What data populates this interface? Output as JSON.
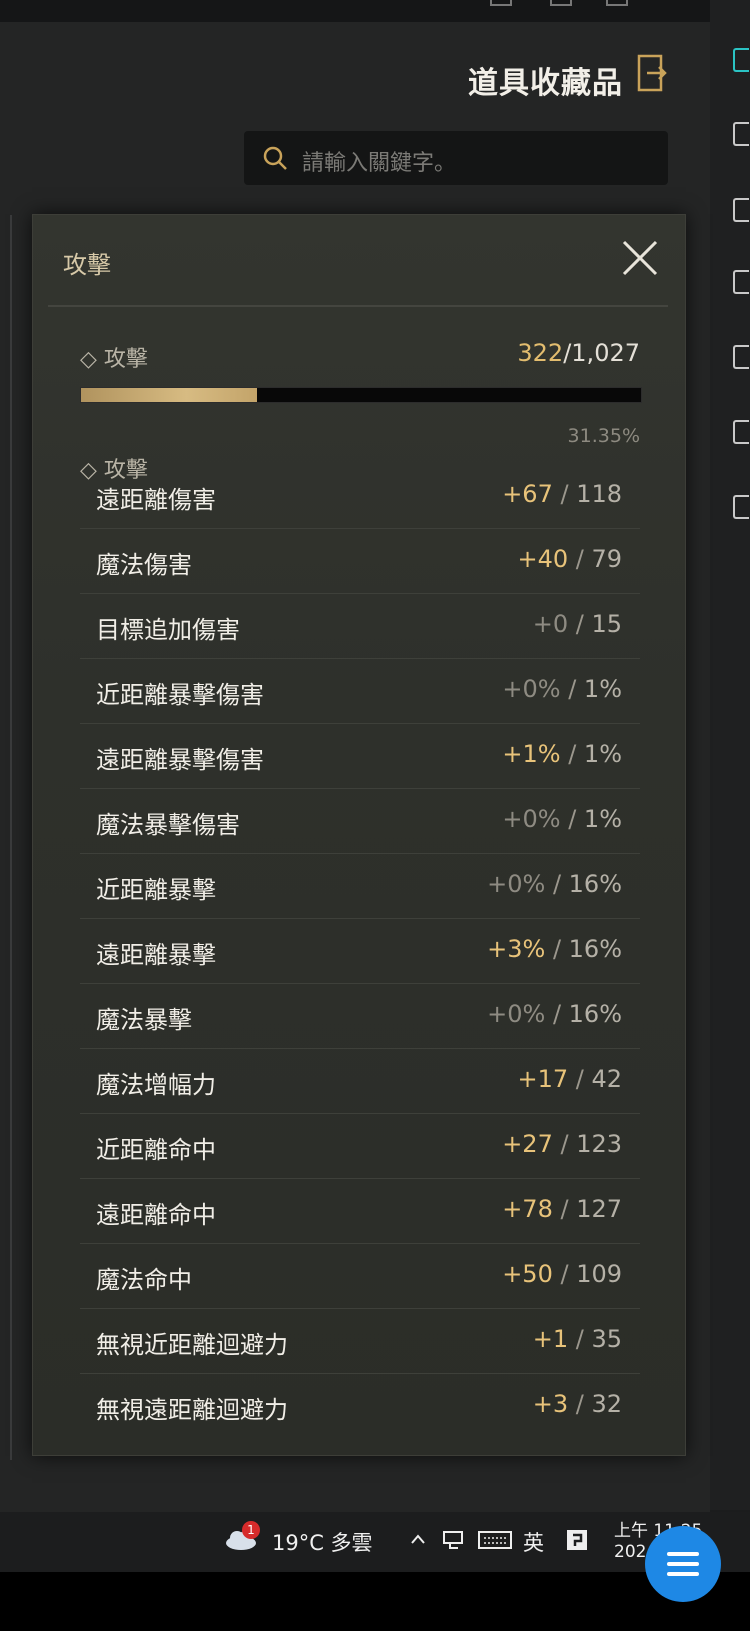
{
  "header": {
    "title": "道具收藏品"
  },
  "search": {
    "placeholder": "請輸入關鍵字。"
  },
  "panel": {
    "title": "攻擊",
    "summary": {
      "label": "◇ 攻擊",
      "current": "322",
      "total": "/1,027",
      "percent_text": "31.35%",
      "progress": 0.3135
    },
    "section_label": "◇ 攻擊",
    "rows": [
      {
        "name": "遠距離傷害",
        "bonus": "+67",
        "max": "118",
        "zero": false
      },
      {
        "name": "魔法傷害",
        "bonus": "+40",
        "max": "79",
        "zero": false
      },
      {
        "name": "目標追加傷害",
        "bonus": "+0",
        "max": "15",
        "zero": true
      },
      {
        "name": "近距離暴擊傷害",
        "bonus": "+0%",
        "max": "1%",
        "zero": true
      },
      {
        "name": "遠距離暴擊傷害",
        "bonus": "+1%",
        "max": "1%",
        "zero": false
      },
      {
        "name": "魔法暴擊傷害",
        "bonus": "+0%",
        "max": "1%",
        "zero": true
      },
      {
        "name": "近距離暴擊",
        "bonus": "+0%",
        "max": "16%",
        "zero": true
      },
      {
        "name": "遠距離暴擊",
        "bonus": "+3%",
        "max": "16%",
        "zero": false
      },
      {
        "name": "魔法暴擊",
        "bonus": "+0%",
        "max": "16%",
        "zero": true
      },
      {
        "name": "魔法增幅力",
        "bonus": "+17",
        "max": "42",
        "zero": false
      },
      {
        "name": "近距離命中",
        "bonus": "+27",
        "max": "123",
        "zero": false
      },
      {
        "name": "遠距離命中",
        "bonus": "+78",
        "max": "127",
        "zero": false
      },
      {
        "name": "魔法命中",
        "bonus": "+50",
        "max": "109",
        "zero": false
      },
      {
        "name": "無視近距離迴避力",
        "bonus": "+1",
        "max": "35",
        "zero": false
      },
      {
        "name": "無視遠距離迴避力",
        "bonus": "+3",
        "max": "32",
        "zero": false
      }
    ]
  },
  "taskbar": {
    "weather_badge": "1",
    "weather": "19°C  多雲",
    "ime": "英",
    "clock_line1": "上午 11:25",
    "clock_line2": "202"
  },
  "colors": {
    "accent_gold": "#e8c37a",
    "panel_bg": "#2f312c",
    "fab": "#1e88e5"
  }
}
